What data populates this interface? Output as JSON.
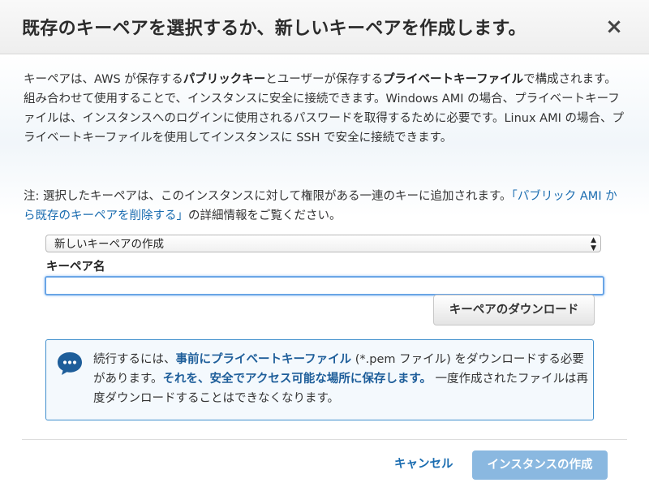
{
  "dialog": {
    "title": "既存のキーペアを選択するか、新しいキーペアを作成します。",
    "close_glyph": "×"
  },
  "intro": {
    "t1": "キーペアは、AWS が保存する",
    "b1": "パブリックキー",
    "t2": "とユーザーが保存する",
    "b2": "プライベートキーファイル",
    "t3": "で構成されます。組み合わせて使用することで、インスタンスに安全に接続できます。Windows AMI の場合、プライベートキーファイルは、インスタンスへのログインに使用されるパスワードを取得するために必要です。Linux AMI の場合、プライベートキーファイルを使用してインスタンスに SSH で安全に接続できます。"
  },
  "note": {
    "prefix": "注: 選択したキーペアは、このインスタンスに対して権限がある一連のキーに追加されます。",
    "link": "「パブリック AMI から既存のキーペアを削除する」",
    "suffix": "の詳細情報をご覧ください。"
  },
  "keypair_select": {
    "selected": "新しいキーペアの作成",
    "arrow_up": "▲",
    "arrow_down": "▼"
  },
  "keypair_name": {
    "label": "キーペア名",
    "value": "",
    "placeholder": ""
  },
  "download_button": {
    "label": "キーペアのダウンロード"
  },
  "info_box": {
    "t1": "続行するには、",
    "b1": "事前にプライベートキーファイル",
    "t2": " (*.pem ファイル) をダウンロードする必要があります。",
    "b2": "それを、安全でアクセス可能な場所に保存します。",
    "t3": " 一度作成されたファイルは再度ダウンロードすることはできなくなります。",
    "icon": "chat-bubble-icon"
  },
  "footer": {
    "cancel_label": "キャンセル",
    "create_label": "インスタンスの作成"
  },
  "colors": {
    "link": "#1a6cb0",
    "info_border": "#3f8fcd",
    "primary_disabled": "#8ab8e0"
  }
}
